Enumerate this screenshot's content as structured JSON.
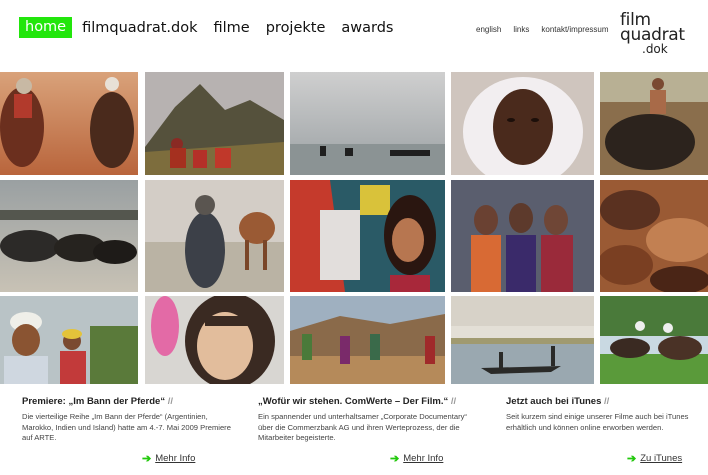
{
  "nav": {
    "items": [
      "home",
      "filmquadrat.dok",
      "filme",
      "projekte",
      "awards"
    ],
    "active": "home"
  },
  "subnav": [
    "english",
    "links",
    "kontakt/impressum"
  ],
  "logo": {
    "line1": "film",
    "line2": "quadrat",
    "line3": ".dok"
  },
  "news": [
    {
      "title": "Premiere: „Im Bann der Pferde“",
      "slash": "//",
      "body": "Die vierteilige Reihe „Im Bann der Pferde“ (Argentinien, Marokko, Indien und Island) hatte am 4.-7. Mai 2009 Premiere auf ARTE.",
      "link": "Mehr Info"
    },
    {
      "title": "„Wofür wir stehen. ComWerte – Der Film.“",
      "slash": "//",
      "body": "Ein spannender und unterhaltsamer „Corporate Documentary“ über die Commerzbank AG und ihren Werteprozess, der die Mitarbeiter begeisterte.",
      "link": "Mehr Info"
    },
    {
      "title": "Jetzt auch bei iTunes",
      "slash": "//",
      "body": "Seit kurzem sind einige unserer Filme auch bei iTunes erhältlich und können online erworben werden.",
      "link": "Zu iTunes"
    }
  ],
  "colors": {
    "accent": "#22e60c",
    "arrow": "#22c80c"
  }
}
